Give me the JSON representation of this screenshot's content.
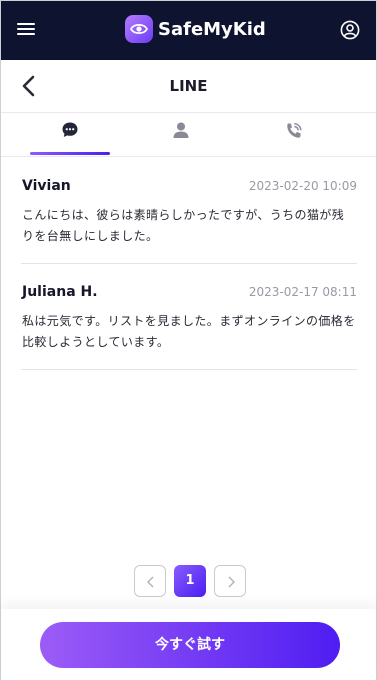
{
  "app": {
    "name": "SafeMyKid"
  },
  "header": {
    "title": "LINE"
  },
  "tabs": [
    {
      "icon": "chat-bubble-icon",
      "active": true
    },
    {
      "icon": "person-icon",
      "active": false
    },
    {
      "icon": "phone-icon",
      "active": false
    }
  ],
  "messages": [
    {
      "name": "Vivian",
      "time": "2023-02-20 10:09",
      "text": "こんにちは、彼らは素晴らしかったですが、うちの猫が残りを台無しにしました。"
    },
    {
      "name": "Juliana H.",
      "time": "2023-02-17 08:11",
      "text": "私は元気です。リストを見ました。まずオンラインの価格を比較しようとしています。"
    }
  ],
  "pagination": {
    "current": "1"
  },
  "cta": {
    "label": "今すぐ試す"
  },
  "colors": {
    "topbar": "#0e1330",
    "accent": "#5b2cf3"
  }
}
